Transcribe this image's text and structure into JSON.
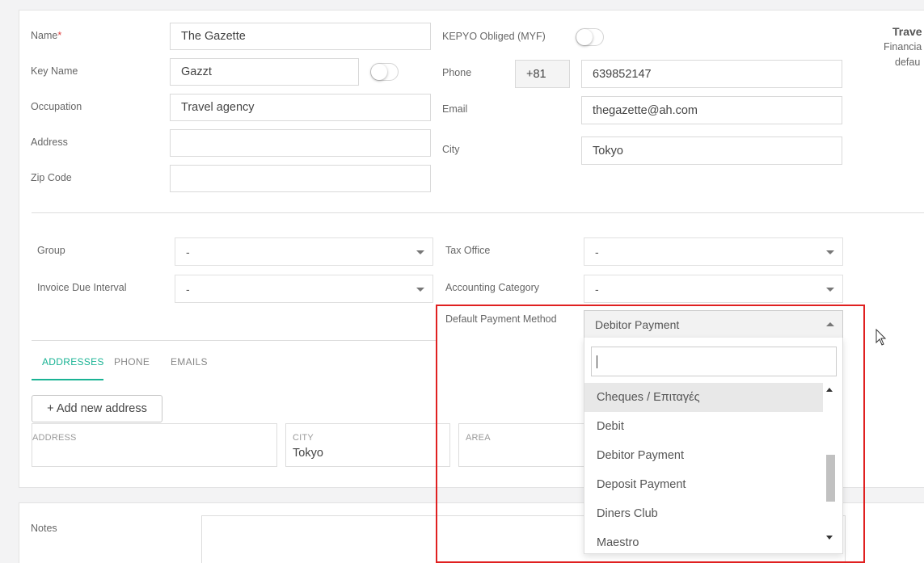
{
  "form": {
    "name_label": "Name",
    "name_required": "*",
    "name_value": "The Gazette",
    "keyname_label": "Key Name",
    "keyname_value": "Gazzt",
    "occupation_label": "Occupation",
    "occupation_value": "Travel agency",
    "address_label": "Address",
    "address_value": "",
    "zipcode_label": "Zip Code",
    "zipcode_value": "",
    "kepyo_label": "KEPYO Obliged (MYF)",
    "phone_label": "Phone",
    "phone_prefix": "+81",
    "phone_value": "639852147",
    "email_label": "Email",
    "email_value": "thegazette@ah.com",
    "city_label": "City",
    "city_value": "Tokyo"
  },
  "side_info": {
    "title": "Trave",
    "line1": "Financia",
    "line2": "defau"
  },
  "settings": {
    "group_label": "Group",
    "group_value": "-",
    "invoice_due_label": "Invoice Due Interval",
    "invoice_due_value": "-",
    "tax_office_label": "Tax Office",
    "tax_office_value": "-",
    "accounting_label": "Accounting Category",
    "accounting_value": "-",
    "payment_label": "Default Payment Method",
    "payment_value": "Debitor Payment"
  },
  "payment_dropdown": {
    "search_value": "",
    "options": [
      "Cheques / Επιταγές",
      "Debit",
      "Debitor Payment",
      "Deposit Payment",
      "Diners Club",
      "Maestro"
    ],
    "highlighted_index": 0
  },
  "tabs": [
    {
      "label": "ADDRESSES",
      "active": true
    },
    {
      "label": "PHONE",
      "active": false
    },
    {
      "label": "EMAILS",
      "active": false
    }
  ],
  "address_section": {
    "add_button": "+ Add new address",
    "columns": [
      {
        "caption": "ADDRESS",
        "value": ""
      },
      {
        "caption": "CITY",
        "value": "Tokyo"
      },
      {
        "caption": "AREA",
        "value": ""
      }
    ]
  },
  "notes": {
    "label": "Notes"
  },
  "colors": {
    "accent": "#1ab394",
    "highlight_box": "#e02020",
    "required": "#e04040"
  }
}
